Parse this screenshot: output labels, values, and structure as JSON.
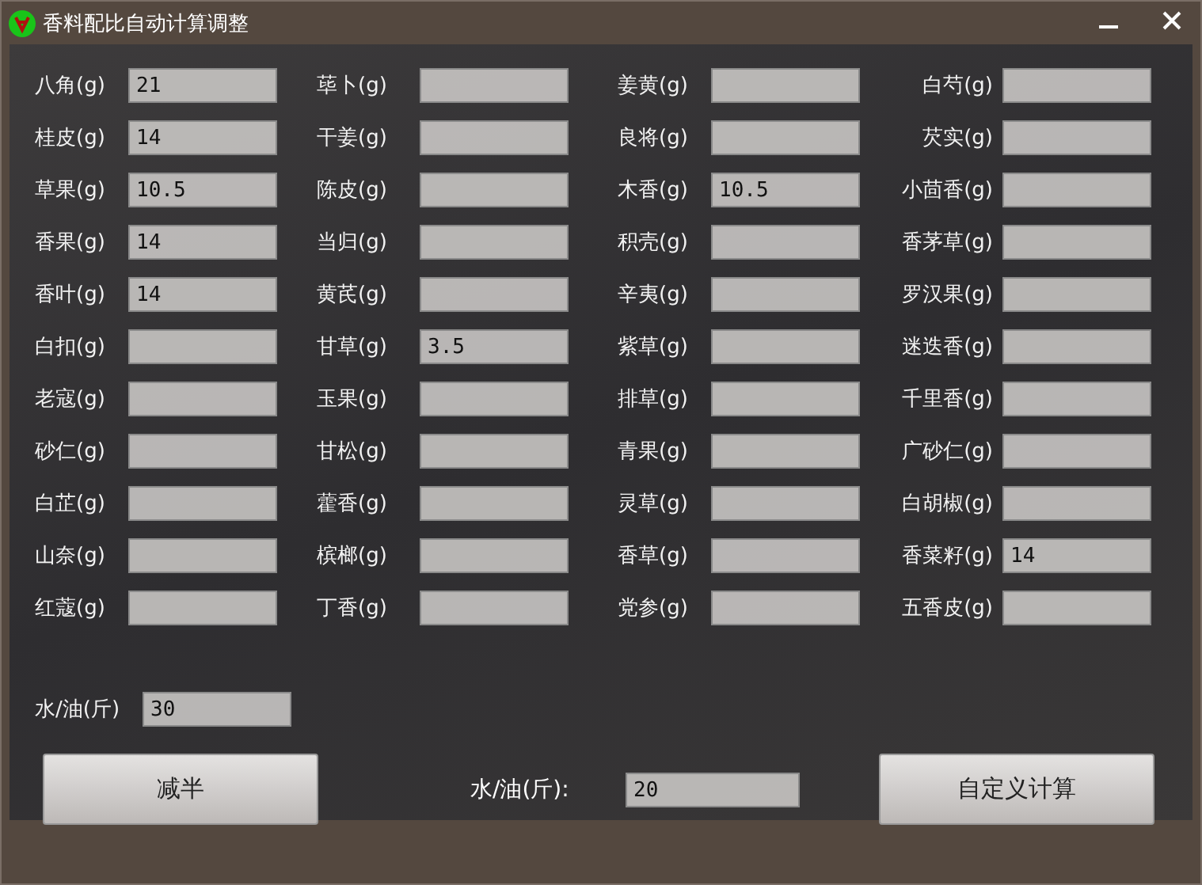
{
  "window": {
    "title": "香料配比自动计算调整"
  },
  "columns": [
    [
      {
        "label": "八角(g)",
        "value": "21"
      },
      {
        "label": "桂皮(g)",
        "value": "14"
      },
      {
        "label": "草果(g)",
        "value": "10.5"
      },
      {
        "label": "香果(g)",
        "value": "14"
      },
      {
        "label": "香叶(g)",
        "value": "14"
      },
      {
        "label": "白扣(g)"
      },
      {
        "label": "老寇(g)"
      },
      {
        "label": "砂仁(g)"
      },
      {
        "label": "白芷(g)"
      },
      {
        "label": "山奈(g)"
      },
      {
        "label": "红蔻(g)"
      }
    ],
    [
      {
        "label": "荜卜(g)"
      },
      {
        "label": "干姜(g)"
      },
      {
        "label": "陈皮(g)"
      },
      {
        "label": "当归(g)"
      },
      {
        "label": "黄芪(g)"
      },
      {
        "label": "甘草(g)",
        "value": "3.5"
      },
      {
        "label": "玉果(g)"
      },
      {
        "label": "甘松(g)"
      },
      {
        "label": "藿香(g)"
      },
      {
        "label": "槟榔(g)"
      },
      {
        "label": "丁香(g)"
      }
    ],
    [
      {
        "label": "姜黄(g)"
      },
      {
        "label": "良将(g)"
      },
      {
        "label": "木香(g)",
        "value": "10.5"
      },
      {
        "label": "积壳(g)"
      },
      {
        "label": "辛夷(g)"
      },
      {
        "label": "紫草(g)"
      },
      {
        "label": "排草(g)"
      },
      {
        "label": "青果(g)"
      },
      {
        "label": "灵草(g)"
      },
      {
        "label": "香草(g)"
      },
      {
        "label": "党参(g)"
      }
    ],
    [
      {
        "label": "白芍(g)"
      },
      {
        "label": "芡实(g)"
      },
      {
        "label": "小茴香(g)"
      },
      {
        "label": "香茅草(g)"
      },
      {
        "label": "罗汉果(g)"
      },
      {
        "label": "迷迭香(g)"
      },
      {
        "label": "千里香(g)"
      },
      {
        "label": "广砂仁(g)"
      },
      {
        "label": "白胡椒(g)"
      },
      {
        "label": "香菜籽(g)",
        "value": "14"
      },
      {
        "label": "五香皮(g)"
      }
    ]
  ],
  "water_oil": {
    "label": "水/油(斤)",
    "value": "30"
  },
  "halve_button": {
    "label": "减半"
  },
  "target_water_oil": {
    "label": "水/油(斤):",
    "value": "20"
  },
  "custom_button": {
    "label": "自定义计算"
  }
}
